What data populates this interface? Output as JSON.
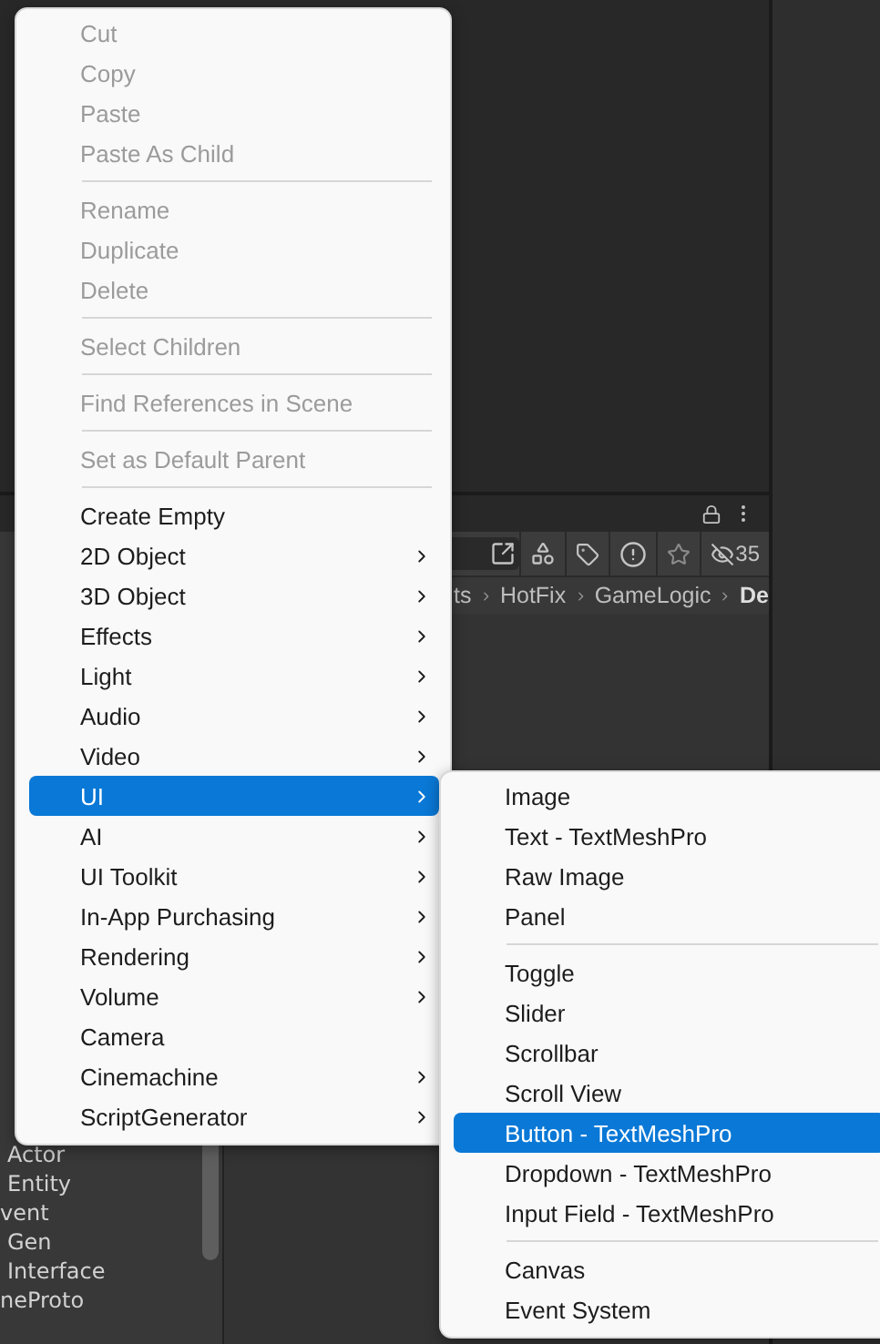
{
  "hierarchy_panel": {
    "items": [
      "Actor",
      "Entity",
      "vent",
      "Gen",
      "Interface",
      "neProto"
    ]
  },
  "project_panel": {
    "hidden_count": "35",
    "breadcrumb": [
      {
        "label": "ts",
        "current": false
      },
      {
        "label": "HotFix",
        "current": false
      },
      {
        "label": "GameLogic",
        "current": false
      },
      {
        "label": "De",
        "current": true
      }
    ]
  },
  "context_menu": {
    "groups": [
      [
        {
          "label": "Cut",
          "disabled": true,
          "submenu": false,
          "selected": false
        },
        {
          "label": "Copy",
          "disabled": true,
          "submenu": false,
          "selected": false
        },
        {
          "label": "Paste",
          "disabled": true,
          "submenu": false,
          "selected": false
        },
        {
          "label": "Paste As Child",
          "disabled": true,
          "submenu": false,
          "selected": false
        }
      ],
      [
        {
          "label": "Rename",
          "disabled": true,
          "submenu": false,
          "selected": false
        },
        {
          "label": "Duplicate",
          "disabled": true,
          "submenu": false,
          "selected": false
        },
        {
          "label": "Delete",
          "disabled": true,
          "submenu": false,
          "selected": false
        }
      ],
      [
        {
          "label": "Select Children",
          "disabled": true,
          "submenu": false,
          "selected": false
        }
      ],
      [
        {
          "label": "Find References in Scene",
          "disabled": true,
          "submenu": false,
          "selected": false
        }
      ],
      [
        {
          "label": "Set as Default Parent",
          "disabled": true,
          "submenu": false,
          "selected": false
        }
      ],
      [
        {
          "label": "Create Empty",
          "disabled": false,
          "submenu": false,
          "selected": false
        },
        {
          "label": "2D Object",
          "disabled": false,
          "submenu": true,
          "selected": false
        },
        {
          "label": "3D Object",
          "disabled": false,
          "submenu": true,
          "selected": false
        },
        {
          "label": "Effects",
          "disabled": false,
          "submenu": true,
          "selected": false
        },
        {
          "label": "Light",
          "disabled": false,
          "submenu": true,
          "selected": false
        },
        {
          "label": "Audio",
          "disabled": false,
          "submenu": true,
          "selected": false
        },
        {
          "label": "Video",
          "disabled": false,
          "submenu": true,
          "selected": false
        },
        {
          "label": "UI",
          "disabled": false,
          "submenu": true,
          "selected": true
        },
        {
          "label": "AI",
          "disabled": false,
          "submenu": true,
          "selected": false
        },
        {
          "label": "UI Toolkit",
          "disabled": false,
          "submenu": true,
          "selected": false
        },
        {
          "label": "In-App Purchasing",
          "disabled": false,
          "submenu": true,
          "selected": false
        },
        {
          "label": "Rendering",
          "disabled": false,
          "submenu": true,
          "selected": false
        },
        {
          "label": "Volume",
          "disabled": false,
          "submenu": true,
          "selected": false
        },
        {
          "label": "Camera",
          "disabled": false,
          "submenu": false,
          "selected": false
        },
        {
          "label": "Cinemachine",
          "disabled": false,
          "submenu": true,
          "selected": false
        },
        {
          "label": "ScriptGenerator",
          "disabled": false,
          "submenu": true,
          "selected": false
        }
      ]
    ]
  },
  "submenu": {
    "groups": [
      [
        {
          "label": "Image",
          "disabled": false,
          "submenu": false,
          "selected": false
        },
        {
          "label": "Text - TextMeshPro",
          "disabled": false,
          "submenu": false,
          "selected": false
        },
        {
          "label": "Raw Image",
          "disabled": false,
          "submenu": false,
          "selected": false
        },
        {
          "label": "Panel",
          "disabled": false,
          "submenu": false,
          "selected": false
        }
      ],
      [
        {
          "label": "Toggle",
          "disabled": false,
          "submenu": false,
          "selected": false
        },
        {
          "label": "Slider",
          "disabled": false,
          "submenu": false,
          "selected": false
        },
        {
          "label": "Scrollbar",
          "disabled": false,
          "submenu": false,
          "selected": false
        },
        {
          "label": "Scroll View",
          "disabled": false,
          "submenu": false,
          "selected": false
        },
        {
          "label": "Button - TextMeshPro",
          "disabled": false,
          "submenu": false,
          "selected": true
        },
        {
          "label": "Dropdown - TextMeshPro",
          "disabled": false,
          "submenu": false,
          "selected": false
        },
        {
          "label": "Input Field - TextMeshPro",
          "disabled": false,
          "submenu": false,
          "selected": false
        }
      ],
      [
        {
          "label": "Canvas",
          "disabled": false,
          "submenu": false,
          "selected": false
        },
        {
          "label": "Event System",
          "disabled": false,
          "submenu": false,
          "selected": false
        }
      ]
    ]
  }
}
